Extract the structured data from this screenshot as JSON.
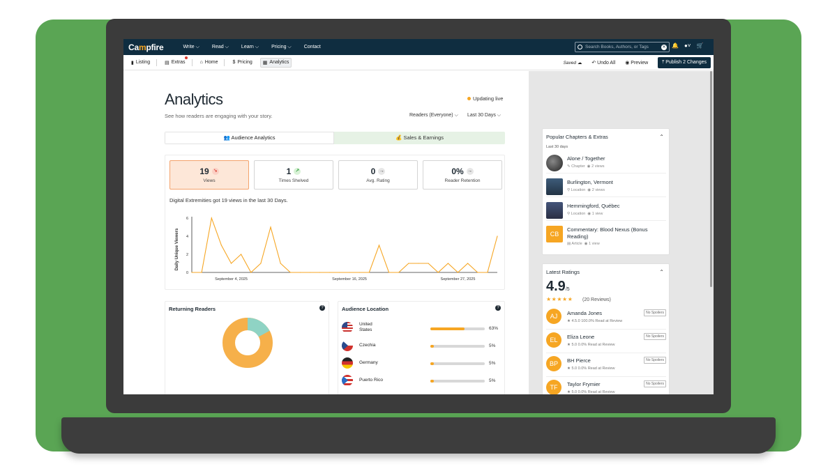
{
  "app": {
    "logo_left": "Ca",
    "logo_accent": "m",
    "logo_right": "pfire"
  },
  "nav": {
    "links": [
      "Write ⌵",
      "Read ⌵",
      "Learn ⌵",
      "Pricing ⌵",
      "Contact"
    ],
    "search_placeholder": "Search Books, Authors, or Tags"
  },
  "subnav": {
    "tabs": [
      "Listing",
      "Extras",
      "Home",
      "Pricing",
      "Analytics"
    ],
    "saved": "Saved",
    "undo": "Undo All",
    "preview": "Preview",
    "publish": "Publish 2 Changes"
  },
  "page": {
    "title": "Analytics",
    "subtitle": "See how readers are engaging with your story.",
    "live": "Updating live",
    "filter_readers": "Readers (Everyone) ⌵",
    "filter_range": "Last 30 Days ⌵",
    "tab_audience": "👥 Audience Analytics",
    "tab_sales": "💰 Sales & Earnings"
  },
  "stats": [
    {
      "value": "19",
      "label": "Views",
      "trend": "↘"
    },
    {
      "value": "1",
      "label": "Times Shelved",
      "trend": "↗"
    },
    {
      "value": "0",
      "label": "Avg. Rating",
      "trend": "→"
    },
    {
      "value": "0%",
      "label": "Reader Retention",
      "trend": "→"
    }
  ],
  "summary": "Digital Extremities got 19 views in the last 30 Days.",
  "chart_data": {
    "type": "line",
    "ylabel": "Daily Unique Viewers",
    "ylim": [
      0,
      6
    ],
    "yticks": [
      "6",
      "4",
      "2",
      "0"
    ],
    "xticks": [
      "September 4, 2025",
      "September 16, 2025",
      "September 27, 2025"
    ],
    "values": [
      0,
      0,
      6,
      3,
      1,
      2,
      0,
      1,
      5,
      1,
      0,
      0,
      0,
      0,
      0,
      0,
      0,
      0,
      0,
      3,
      0,
      0,
      1,
      1,
      1,
      0,
      1,
      0,
      1,
      0,
      0,
      4
    ],
    "color": "#f6a623"
  },
  "returning": {
    "title": "Returning Readers",
    "new_color": "#f6b04a",
    "returning_color": "#8fd3c4",
    "returning_fraction": 0.17
  },
  "location": {
    "title": "Audience Location",
    "rows": [
      {
        "name": "United States",
        "pct": "63%",
        "fraction": 0.63
      },
      {
        "name": "Czechia",
        "pct": "5%",
        "fraction": 0.05
      },
      {
        "name": "Germany",
        "pct": "5%",
        "fraction": 0.05
      },
      {
        "name": "Puerto Rico",
        "pct": "5%",
        "fraction": 0.05
      }
    ]
  },
  "popular": {
    "title": "Popular Chapters & Extras",
    "sub": "Last 30 days",
    "items": [
      {
        "name": "Alone / Together",
        "type": "Chapter",
        "views": "2 views"
      },
      {
        "name": "Burlington, Vermont",
        "type": "Location",
        "views": "2 views"
      },
      {
        "name": "Hemmingford, Québec",
        "type": "Location",
        "views": "1 view"
      },
      {
        "name": "Commentary: Blood Nexus (Bonus Reading)",
        "type": "Article",
        "views": "1 view",
        "initials": "CB"
      }
    ]
  },
  "ratings": {
    "title": "Latest Ratings",
    "score": "4.9",
    "out_of": "/5",
    "stars": "★★★★★",
    "count": "(20 Reviews)",
    "spoiler": "No Spoilers",
    "items": [
      {
        "initials": "AJ",
        "name": "Amanda Jones",
        "meta": "4.5.0   100.0% Read at Review"
      },
      {
        "initials": "EL",
        "name": "Eliza Leone",
        "meta": "5.0   0.0% Read at Review"
      },
      {
        "initials": "BP",
        "name": "BH Pierce",
        "meta": "5.0   0.0% Read at Review"
      },
      {
        "initials": "TF",
        "name": "Taylor Frymier",
        "meta": "5.0   0.0% Read at Review"
      }
    ]
  }
}
